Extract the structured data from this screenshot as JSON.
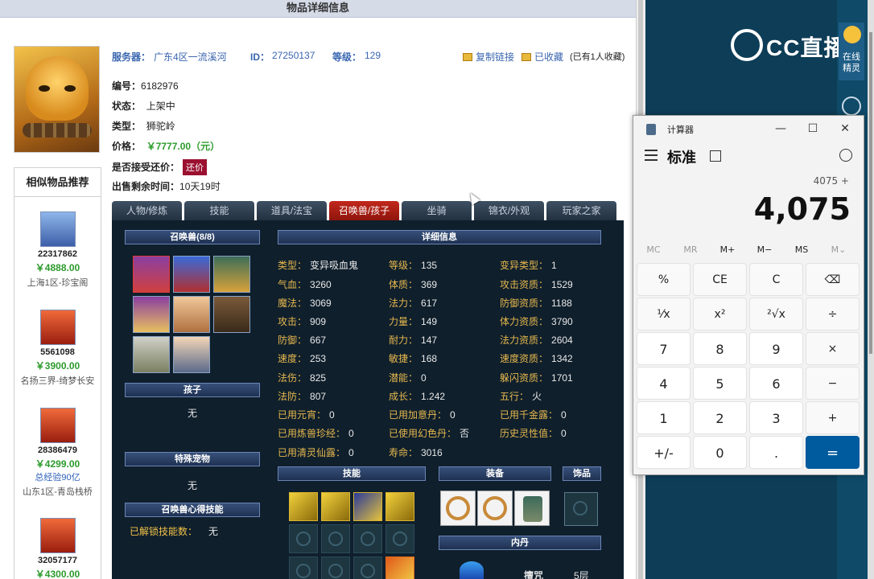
{
  "page_title": "物品详细信息",
  "item": {
    "server_label": "服务器：",
    "server": "广东4区一流溪河",
    "id_label": "ID：",
    "id": "27250137",
    "level_label": "等级：",
    "level": "129",
    "copy_link": "复制链接",
    "favorited": "已收藏",
    "favorite_count": "(已有1人收藏)",
    "number_label": "编号：",
    "number": "6182976",
    "status_label": "状态：",
    "status": "上架中",
    "type_label": "类型：",
    "type": "狮驼岭",
    "price_label": "价格：",
    "price": "￥7777.00（元）",
    "bargain_label": "是否接受还价：",
    "bargain_btn": "还价",
    "remaining_label": "出售剩余时间：",
    "remaining": "10天19时"
  },
  "similar": {
    "title": "相似物品推荐",
    "items": [
      {
        "id": "22317862",
        "price": "￥4888.00",
        "exp": "",
        "server": "上海1区-珍宝阁"
      },
      {
        "id": "5561098",
        "price": "￥3900.00",
        "exp": "",
        "server": "名扬三界-绮梦长安"
      },
      {
        "id": "28386479",
        "price": "￥4299.00",
        "exp": "总经验90亿",
        "server": "山东1区-青岛栈桥"
      },
      {
        "id": "32057177",
        "price": "￥4300.00",
        "exp": "",
        "server": ""
      }
    ]
  },
  "tabs": [
    "人物/修炼",
    "技能",
    "道具/法宝",
    "召唤兽/孩子",
    "坐骑",
    "锦衣/外观",
    "玩家之家"
  ],
  "pets": {
    "title": "召唤兽(8/8)",
    "child_title": "孩子",
    "child_value": "无",
    "special_title": "特殊宠物",
    "special_value": "无",
    "insight_title": "召唤兽心得技能",
    "insight_label": "已解锁技能数：",
    "insight_value": "无"
  },
  "detail": {
    "title": "详细信息",
    "col1": [
      {
        "k": "类型：",
        "v": "变异吸血鬼"
      },
      {
        "k": "气血：",
        "v": "3260"
      },
      {
        "k": "魔法：",
        "v": "3069"
      },
      {
        "k": "攻击：",
        "v": "909"
      },
      {
        "k": "防御：",
        "v": "667"
      },
      {
        "k": "速度：",
        "v": "253"
      },
      {
        "k": "法伤：",
        "v": "825"
      },
      {
        "k": "法防：",
        "v": "807"
      },
      {
        "k": "已用元宵：",
        "v": "0"
      },
      {
        "k": "已用炼兽珍经：",
        "v": "0"
      },
      {
        "k": "已用清灵仙露：",
        "v": "0"
      }
    ],
    "col2": [
      {
        "k": "等级：",
        "v": "135"
      },
      {
        "k": "体质：",
        "v": "369"
      },
      {
        "k": "法力：",
        "v": "617"
      },
      {
        "k": "力量：",
        "v": "149"
      },
      {
        "k": "耐力：",
        "v": "147"
      },
      {
        "k": "敏捷：",
        "v": "168"
      },
      {
        "k": "潜能：",
        "v": "0"
      },
      {
        "k": "成长：",
        "v": "1.242"
      },
      {
        "k": "已用加意丹：",
        "v": "0"
      },
      {
        "k": "已使用幻色丹：",
        "v": "否"
      },
      {
        "k": "寿命：",
        "v": "3016"
      }
    ],
    "col3": [
      {
        "k": "变异类型：",
        "v": "1"
      },
      {
        "k": "攻击资质：",
        "v": "1529"
      },
      {
        "k": "防御资质：",
        "v": "1188"
      },
      {
        "k": "体力资质：",
        "v": "3790"
      },
      {
        "k": "法力资质：",
        "v": "2604"
      },
      {
        "k": "速度资质：",
        "v": "1342"
      },
      {
        "k": "躲闪资质：",
        "v": "1701"
      },
      {
        "k": "五行：",
        "v": "火"
      },
      {
        "k": "已用千金露：",
        "v": "0"
      },
      {
        "k": "历史灵性值：",
        "v": "0"
      }
    ]
  },
  "skills_title": "技能",
  "equip_title": "装备",
  "accessory_title": "饰品",
  "neidan": {
    "title": "内丹",
    "name": "擅咒",
    "level": "5层"
  },
  "right": {
    "brand": "CC直播",
    "online_label": "在线精灵"
  },
  "calculator": {
    "title": "计算器",
    "mode": "标准",
    "expression": "4075 +",
    "display": "4,075",
    "memory": [
      "MC",
      "MR",
      "M+",
      "M−",
      "MS",
      "M⌄"
    ],
    "keys": [
      "%",
      "CE",
      "C",
      "⌫",
      "¹⁄x",
      "x²",
      "²√x",
      "÷",
      "7",
      "8",
      "9",
      "×",
      "4",
      "5",
      "6",
      "−",
      "1",
      "2",
      "3",
      "+",
      "+/-",
      "0",
      ".",
      "="
    ]
  }
}
